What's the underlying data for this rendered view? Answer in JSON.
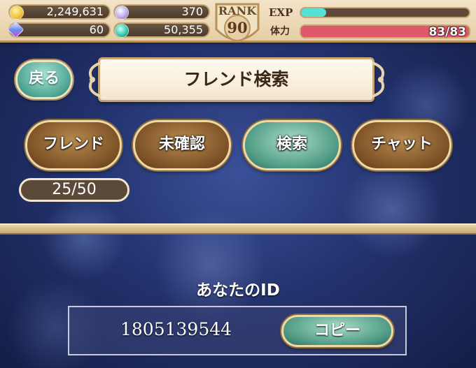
{
  "status_bar": {
    "gold": "2,249,631",
    "feather": "370",
    "crystal": "60",
    "gem": "50,355",
    "rank_label": "RANK",
    "rank_value": "90",
    "exp_label": "EXP",
    "exp_progress": 0.15,
    "hp_label": "体力",
    "hp_text": "83/83",
    "hp_progress": 1.0,
    "colors": {
      "exp": "#57e0d6",
      "hp": "#e0586a",
      "gold": "#f2c33a",
      "gem": "#3fc9b0"
    }
  },
  "header": {
    "back_label": "戻る",
    "title": "フレンド検索"
  },
  "tabs": [
    {
      "label": "フレンド",
      "active": false
    },
    {
      "label": "未確認",
      "active": false
    },
    {
      "label": "検索",
      "active": true
    },
    {
      "label": "チャット",
      "active": false
    }
  ],
  "friend_count": "25/50",
  "id_section": {
    "label": "あなたのID",
    "value": "1805139544",
    "copy_label": "コピー"
  }
}
